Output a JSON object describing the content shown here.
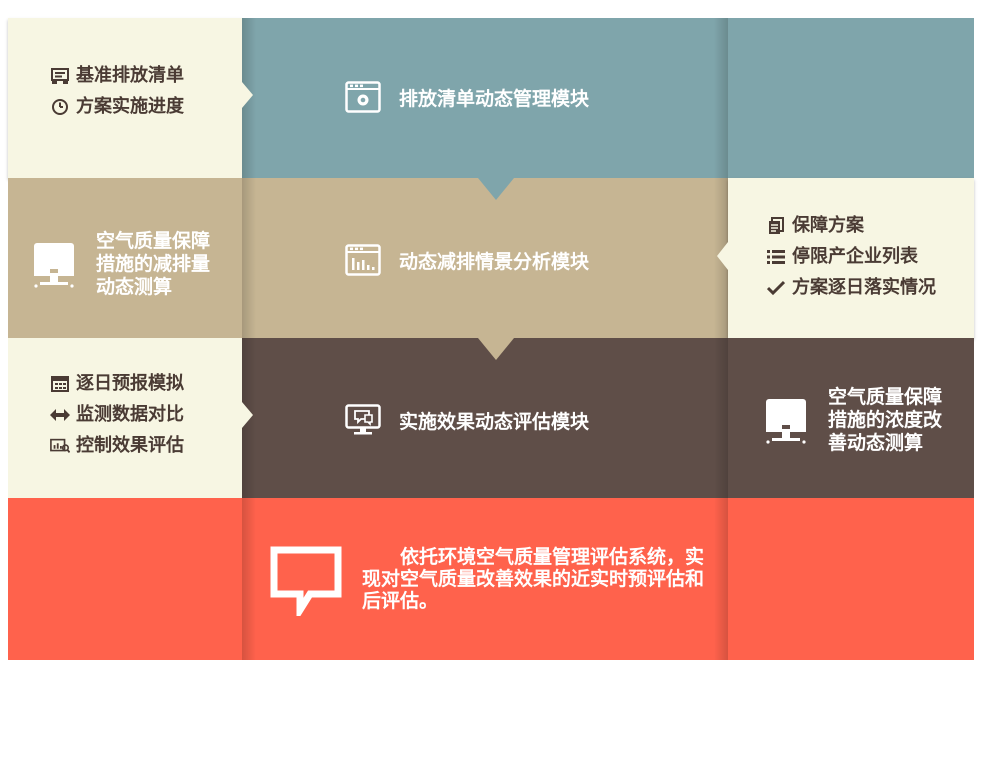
{
  "colors": {
    "cream": "#f7f6e3",
    "teal": "#7fa5ab",
    "tan": "#c6b593",
    "brown": "#5f4e48",
    "coral": "#ff624c",
    "dark_text": "#4a3b34"
  },
  "row1": {
    "left_items": [
      {
        "icon": "list-doc-icon",
        "label": "基准排放清单"
      },
      {
        "icon": "clock-icon",
        "label": "方案实施进度"
      }
    ],
    "module": {
      "icon": "browser-gear-icon",
      "label": "排放清单动态管理模块"
    }
  },
  "row2": {
    "left_block": {
      "icon": "monitor-icon",
      "lines": [
        "空气质量保障",
        "措施的减排量",
        "动态测算"
      ]
    },
    "module": {
      "icon": "browser-chart-icon",
      "label": "动态减排情景分析模块"
    },
    "right_items": [
      {
        "icon": "document-icon",
        "label": "保障方案"
      },
      {
        "icon": "bullet-list-icon",
        "label": "停限产企业列表"
      },
      {
        "icon": "checkmark-icon",
        "label": "方案逐日落实情况"
      }
    ]
  },
  "row3": {
    "left_items": [
      {
        "icon": "calendar-icon",
        "label": "逐日预报模拟"
      },
      {
        "icon": "double-arrow-icon",
        "label": "监测数据对比"
      },
      {
        "icon": "chart-search-icon",
        "label": "控制效果评估"
      }
    ],
    "module": {
      "icon": "monitor-chat-icon",
      "label": "实施效果动态评估模块"
    },
    "right_block": {
      "icon": "monitor-icon",
      "lines": [
        "空气质量保障",
        "措施的浓度改",
        "善动态测算"
      ]
    }
  },
  "summary": {
    "icon": "speech-bubble-icon",
    "lines": [
      "　　依托环境空气质量管理评估系统，实",
      "现对空气质量改善效果的近实时预评估和",
      "后评估。"
    ]
  }
}
